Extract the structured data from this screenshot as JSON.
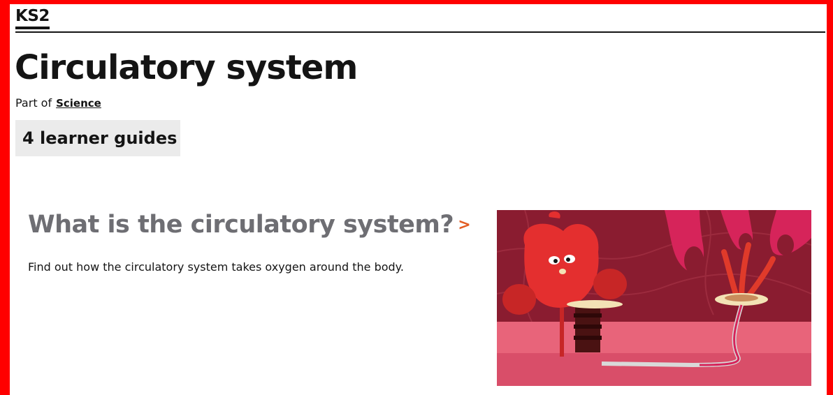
{
  "header": {
    "level": "KS2"
  },
  "page": {
    "title": "Circulatory system",
    "part_of_prefix": "Part of",
    "subject": "Science",
    "guide_count": "4 learner guides"
  },
  "guide": {
    "title": "What is the circulatory system?",
    "chevron": ">",
    "description": "Find out how the circulatory system takes oxygen around the body.",
    "image_icon": "heart-illustration"
  },
  "colors": {
    "frame": "#ff0000",
    "text": "#141414",
    "card_title": "#6e6e73",
    "accent": "#e35c22",
    "count_bg": "#ebebeb"
  }
}
